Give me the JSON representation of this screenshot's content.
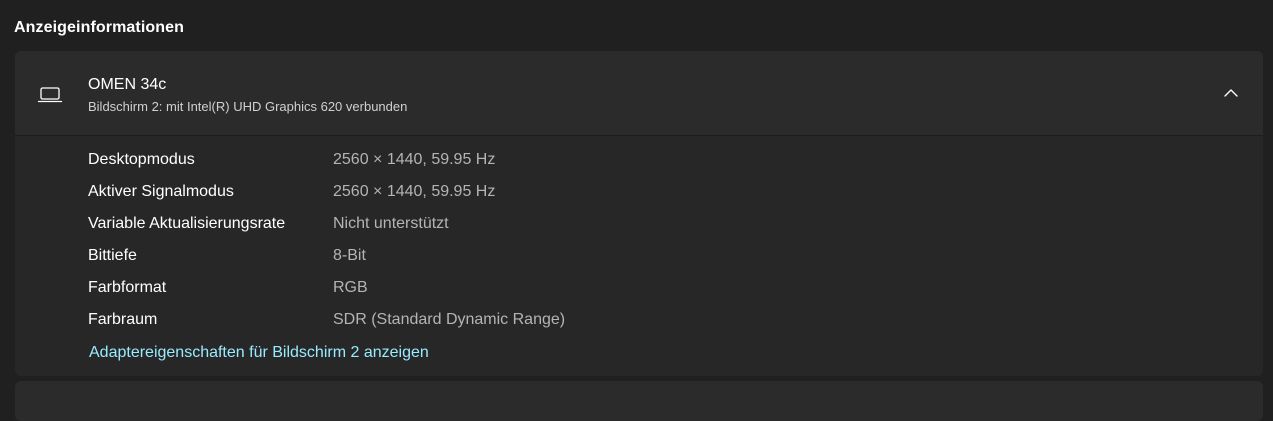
{
  "section": {
    "title": "Anzeigeinformationen"
  },
  "monitor": {
    "icon": "laptop-icon",
    "name": "OMEN 34c",
    "subtitle": "Bildschirm 2: mit Intel(R) UHD Graphics 620 verbunden",
    "expanded": true,
    "chevron_icon": "chevron-up-icon"
  },
  "details": [
    {
      "label": "Desktopmodus",
      "value": "2560 × 1440, 59.95 Hz"
    },
    {
      "label": "Aktiver Signalmodus",
      "value": "2560 × 1440, 59.95 Hz"
    },
    {
      "label": "Variable Aktualisierungsrate",
      "value": "Nicht unterstützt"
    },
    {
      "label": "Bittiefe",
      "value": "8-Bit"
    },
    {
      "label": "Farbformat",
      "value": "RGB"
    },
    {
      "label": "Farbraum",
      "value": "SDR (Standard Dynamic Range)"
    }
  ],
  "link": {
    "label": "Adaptereigenschaften für Bildschirm 2 anzeigen"
  },
  "colors": {
    "background": "#202020",
    "card": "#2b2b2b",
    "card_body": "#272727",
    "link": "#99ebff",
    "value_text": "#b4b4b4"
  }
}
